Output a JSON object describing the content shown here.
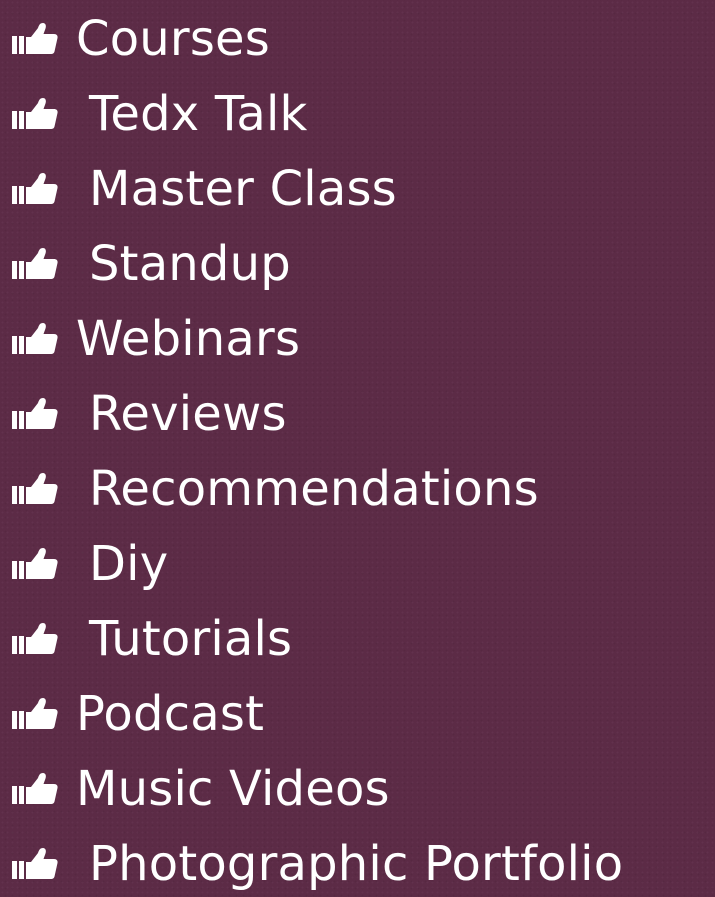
{
  "page": {
    "background_color": "#5c2b46",
    "text_color": "#ffffff",
    "bullet_icon": "thumbs-up-icon"
  },
  "items": [
    {
      "label": "Courses"
    },
    {
      "label": "Tedx Talk"
    },
    {
      "label": "Master Class"
    },
    {
      "label": "Standup"
    },
    {
      "label": "Webinars"
    },
    {
      "label": "Reviews"
    },
    {
      "label": "Recommendations"
    },
    {
      "label": "Diy"
    },
    {
      "label": "Tutorials"
    },
    {
      "label": "Podcast"
    },
    {
      "label": "Music Videos"
    },
    {
      "label": "Photographic Portfolio"
    }
  ]
}
